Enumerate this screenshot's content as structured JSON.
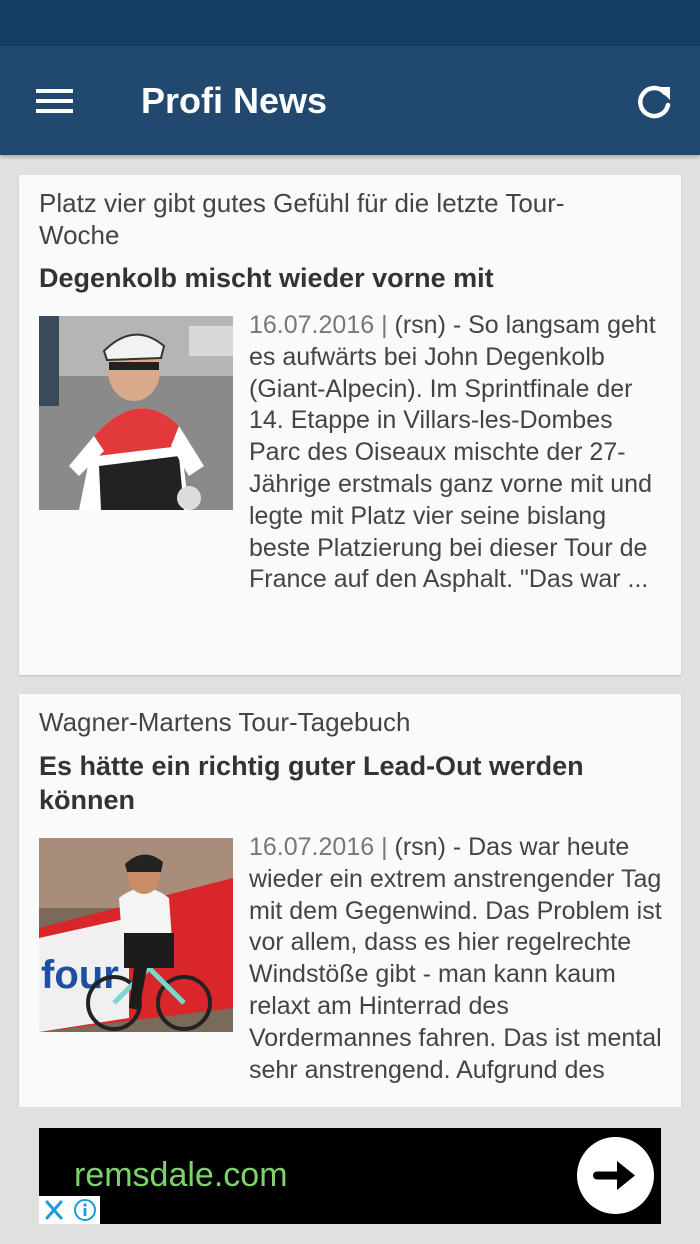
{
  "app_bar": {
    "title": "Profi News",
    "menu_icon": "hamburger-menu-icon",
    "refresh_icon": "refresh-icon",
    "color": "#21496f",
    "status_bar_color": "#173f66"
  },
  "articles": [
    {
      "kicker": "Platz vier gibt gutes Gefühl für die letzte Tour-Woche",
      "headline": "Degenkolb mischt wieder vorne mit",
      "date": "16.07.2016 |",
      "teaser": "(rsn) - So langsam geht es aufwärts bei John Degenkolb (Giant-Alpecin). Im Sprintfinale der 14. Etappe in Villars-les-Dombes Parc des Oiseaux mischte der 27-Jährige erstmals ganz vorne mit und legte mit Platz vier seine bislang beste Platzierung bei dieser Tour de France auf den Asphalt. \"Das war ..."
    },
    {
      "kicker": "Wagner-Martens Tour-Tagebuch",
      "headline": "Es hätte ein richtig guter Lead-Out werden können",
      "date": "16.07.2016 |",
      "teaser": "(rsn) - Das war heute wieder ein extrem anstrengender Tag mit dem Gegenwind. Das Problem ist vor allem, dass es hier regelrechte Windstöße gibt - man kann kaum relaxt am Hinterrad des Vordermannes fahren. Das ist mental sehr anstrengend. Aufgrund des"
    }
  ],
  "ad": {
    "url": "remsdale.com",
    "arrow_icon": "arrow-right-icon",
    "close_icon": "close-icon",
    "info_icon": "info-icon",
    "url_color": "#7dd36a"
  }
}
